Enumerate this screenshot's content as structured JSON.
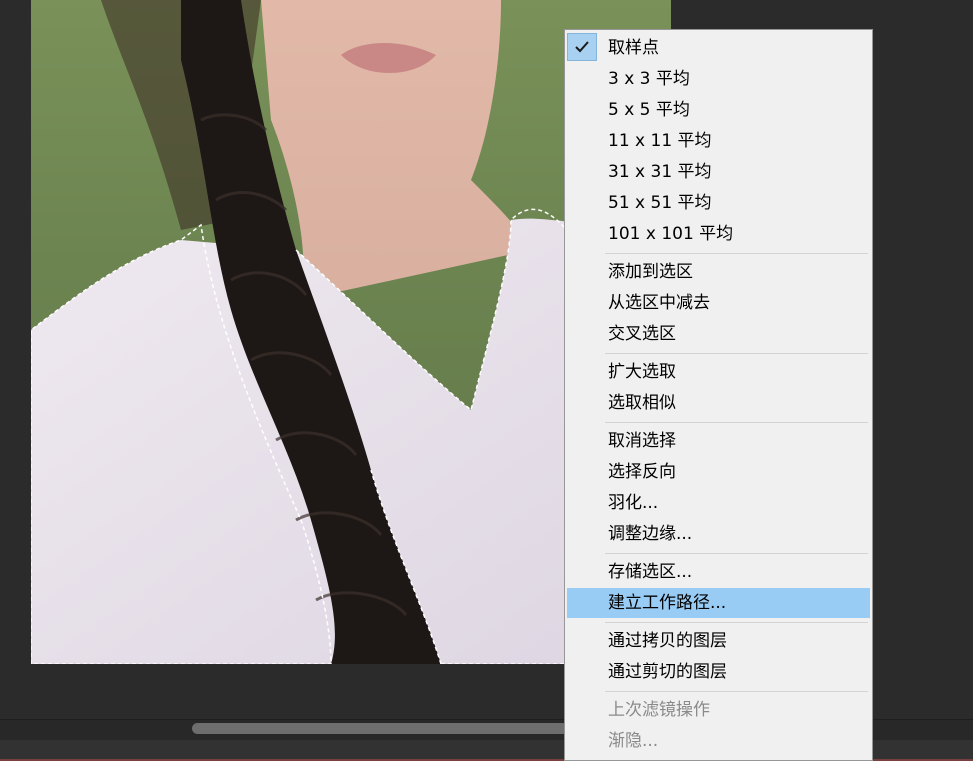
{
  "menu": {
    "groups": [
      [
        {
          "label": "取样点",
          "checked": true
        },
        {
          "label": "3 x 3 平均"
        },
        {
          "label": "5 x 5 平均"
        },
        {
          "label": "11 x 11 平均"
        },
        {
          "label": "31 x 31 平均"
        },
        {
          "label": "51 x 51 平均"
        },
        {
          "label": "101 x 101 平均"
        }
      ],
      [
        {
          "label": "添加到选区"
        },
        {
          "label": "从选区中减去"
        },
        {
          "label": "交叉选区"
        }
      ],
      [
        {
          "label": "扩大选取"
        },
        {
          "label": "选取相似"
        }
      ],
      [
        {
          "label": "取消选择"
        },
        {
          "label": "选择反向"
        },
        {
          "label": "羽化..."
        },
        {
          "label": "调整边缘..."
        }
      ],
      [
        {
          "label": "存储选区..."
        },
        {
          "label": "建立工作路径...",
          "highlighted": true
        }
      ],
      [
        {
          "label": "通过拷贝的图层"
        },
        {
          "label": "通过剪切的图层"
        }
      ],
      [
        {
          "label": "上次滤镜操作",
          "disabled": true
        },
        {
          "label": "渐隐...",
          "disabled": true
        }
      ]
    ]
  },
  "colors": {
    "menu_bg": "#f0f0f0",
    "highlight": "#99ccf5",
    "disabled_text": "#8a8a8a",
    "workspace": "#2b2b2b"
  }
}
